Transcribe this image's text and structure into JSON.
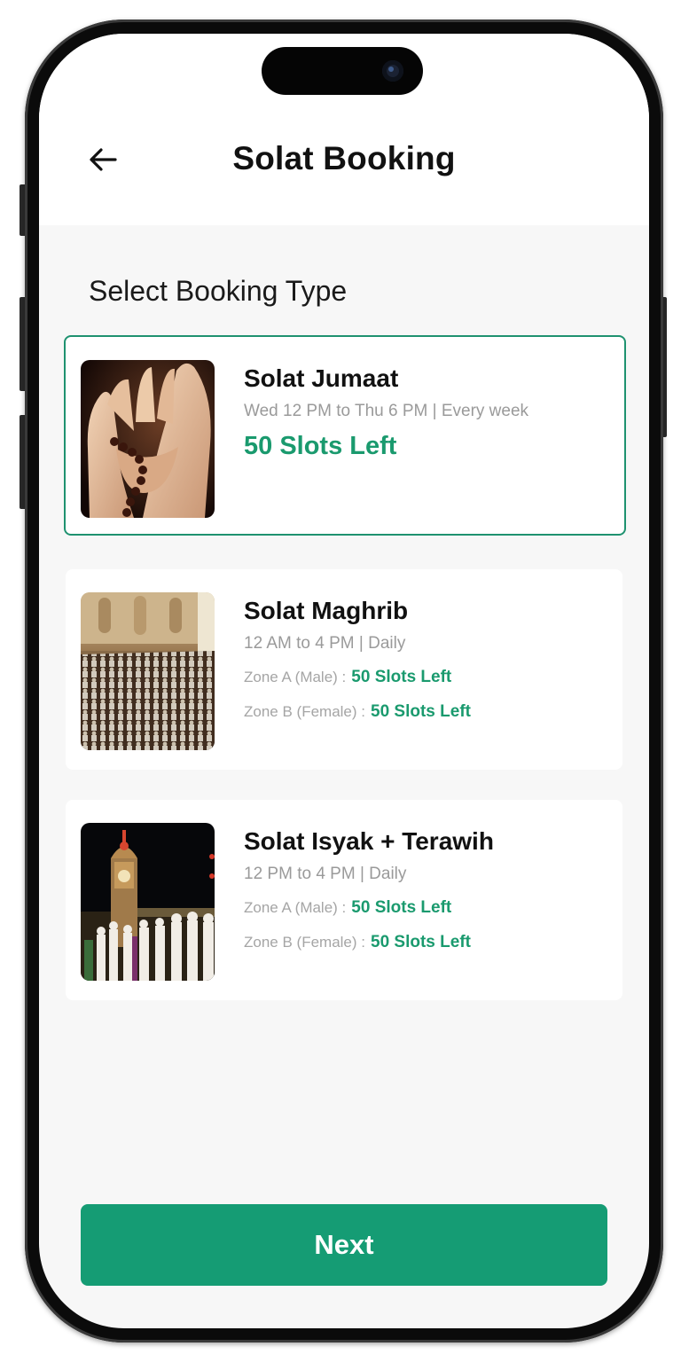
{
  "header": {
    "title": "Solat Booking",
    "back_icon": "arrow-left-icon"
  },
  "section_title": "Select Booking Type",
  "bookings": [
    {
      "title": "Solat Jumaat",
      "schedule": "Wed 12 PM to Thu 6 PM | Every week",
      "slots": "50 Slots Left",
      "selected": true,
      "image": "praying-hands-with-tasbih"
    },
    {
      "title": "Solat Maghrib",
      "schedule": "12 AM to 4 PM | Daily",
      "zones": [
        {
          "label": "Zone A (Male) :",
          "slots": "50 Slots Left"
        },
        {
          "label": "Zone B (Female) :",
          "slots": "50 Slots Left"
        }
      ],
      "selected": false,
      "image": "mosque-congregation-interior"
    },
    {
      "title": "Solat Isyak + Terawih",
      "schedule": "12 PM to 4 PM | Daily",
      "zones": [
        {
          "label": "Zone A (Male) :",
          "slots": "50 Slots Left"
        },
        {
          "label": "Zone B (Female) :",
          "slots": "50 Slots Left"
        }
      ],
      "selected": false,
      "image": "night-clock-tower-worshippers"
    }
  ],
  "next_button": "Next",
  "colors": {
    "accent": "#1a9a6e",
    "button": "#159c74",
    "selected_border": "#1f9270"
  }
}
